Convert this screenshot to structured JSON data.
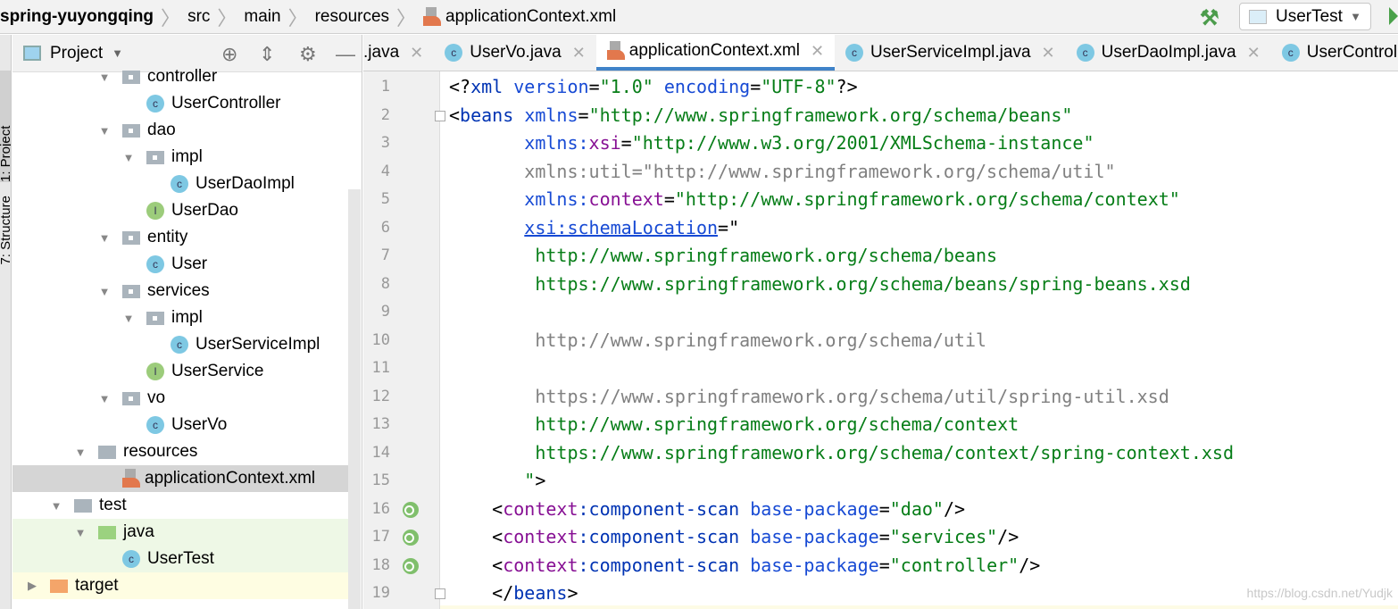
{
  "breadcrumb": [
    "spring-yuyongqing",
    "src",
    "main",
    "resources",
    "applicationContext.xml"
  ],
  "run_config": "UserTest",
  "tool_strip": [
    "1: Project",
    "7: Structure"
  ],
  "project_panel": {
    "title": "Project",
    "tree": [
      {
        "label": "controller",
        "kind": "pkg",
        "level": 4,
        "arrow": "▼"
      },
      {
        "label": "UserController",
        "kind": "class",
        "level": 5
      },
      {
        "label": "dao",
        "kind": "pkg",
        "level": 4,
        "arrow": "▼"
      },
      {
        "label": "impl",
        "kind": "pkg",
        "level": 5,
        "arrow": "▼"
      },
      {
        "label": "UserDaoImpl",
        "kind": "class",
        "level": 6
      },
      {
        "label": "UserDao",
        "kind": "iface",
        "level": 5
      },
      {
        "label": "entity",
        "kind": "pkg",
        "level": 4,
        "arrow": "▼"
      },
      {
        "label": "User",
        "kind": "class",
        "level": 5
      },
      {
        "label": "services",
        "kind": "pkg",
        "level": 4,
        "arrow": "▼"
      },
      {
        "label": "impl",
        "kind": "pkg",
        "level": 5,
        "arrow": "▼"
      },
      {
        "label": "UserServiceImpl",
        "kind": "class",
        "level": 6
      },
      {
        "label": "UserService",
        "kind": "iface",
        "level": 5
      },
      {
        "label": "vo",
        "kind": "pkg",
        "level": 4,
        "arrow": "▼"
      },
      {
        "label": "UserVo",
        "kind": "class",
        "level": 5
      },
      {
        "label": "resources",
        "kind": "res",
        "level": 3,
        "arrow": "▼"
      },
      {
        "label": "applicationContext.xml",
        "kind": "xml",
        "level": 4,
        "selected": true
      },
      {
        "label": "test",
        "kind": "folder",
        "level": 2,
        "arrow": "▼"
      },
      {
        "label": "java",
        "kind": "green",
        "level": 3,
        "arrow": "▼",
        "bg": "green"
      },
      {
        "label": "UserTest",
        "kind": "test",
        "level": 4,
        "bg": "green"
      },
      {
        "label": "target",
        "kind": "orange",
        "level": 1,
        "arrow": "▶",
        "bg": "yellow"
      }
    ]
  },
  "tabs": [
    {
      "label": ".java",
      "icon": "none"
    },
    {
      "label": "UserVo.java",
      "icon": "class"
    },
    {
      "label": "applicationContext.xml",
      "icon": "xml",
      "active": true
    },
    {
      "label": "UserServiceImpl.java",
      "icon": "class"
    },
    {
      "label": "UserDaoImpl.java",
      "icon": "class"
    },
    {
      "label": "UserController",
      "icon": "class",
      "noclose": true
    }
  ],
  "editor": {
    "lines": [
      [
        [
          "p",
          "<?"
        ],
        [
          "tag",
          "xml"
        ],
        [
          "p",
          " "
        ],
        [
          "attr",
          "version"
        ],
        [
          "p",
          "="
        ],
        [
          "val",
          "\"1.0\""
        ],
        [
          "p",
          " "
        ],
        [
          "attr",
          "encoding"
        ],
        [
          "p",
          "="
        ],
        [
          "val",
          "\"UTF-8\""
        ],
        [
          "p",
          "?>"
        ]
      ],
      [
        [
          "p",
          "<"
        ],
        [
          "tag",
          "beans"
        ],
        [
          "p",
          " "
        ],
        [
          "attr",
          "xmlns"
        ],
        [
          "p",
          "="
        ],
        [
          "val",
          "\"http://www.springframework.org/schema/beans\""
        ]
      ],
      [
        [
          "p",
          "       "
        ],
        [
          "attr",
          "xmlns:"
        ],
        [
          "ns",
          "xsi"
        ],
        [
          "p",
          "="
        ],
        [
          "val",
          "\"http://www.w3.org/2001/XMLSchema-instance\""
        ]
      ],
      [
        [
          "p",
          "       "
        ],
        [
          "gray",
          "xmlns:util=\"http://www.springframework.org/schema/util\""
        ]
      ],
      [
        [
          "p",
          "       "
        ],
        [
          "attr",
          "xmlns:"
        ],
        [
          "ns",
          "context"
        ],
        [
          "p",
          "="
        ],
        [
          "val",
          "\"http://www.springframework.org/schema/context\""
        ]
      ],
      [
        [
          "p",
          "       "
        ],
        [
          "und",
          "xsi:schemaLocation"
        ],
        [
          "p",
          "=\""
        ]
      ],
      [
        [
          "p",
          "        "
        ],
        [
          "val",
          "http://www.springframework.org/schema/beans"
        ]
      ],
      [
        [
          "p",
          "        "
        ],
        [
          "val",
          "https://www.springframework.org/schema/beans/spring-beans.xsd"
        ]
      ],
      [],
      [
        [
          "p",
          "        "
        ],
        [
          "gray",
          "http://www.springframework.org/schema/util"
        ]
      ],
      [],
      [
        [
          "p",
          "        "
        ],
        [
          "gray",
          "https://www.springframework.org/schema/util/spring-util.xsd"
        ]
      ],
      [
        [
          "p",
          "        "
        ],
        [
          "val",
          "http://www.springframework.org/schema/context"
        ]
      ],
      [
        [
          "p",
          "        "
        ],
        [
          "val",
          "https://www.springframework.org/schema/context/spring-context.xsd"
        ]
      ],
      [
        [
          "p",
          "       "
        ],
        [
          "val",
          "\""
        ],
        [
          "p",
          ">"
        ]
      ],
      [
        [
          "p",
          "    <"
        ],
        [
          "ns",
          "context"
        ],
        [
          "tag",
          ":component-scan"
        ],
        [
          "p",
          " "
        ],
        [
          "attr",
          "base-package"
        ],
        [
          "p",
          "="
        ],
        [
          "val",
          "\"dao\""
        ],
        [
          "p",
          "/>"
        ]
      ],
      [
        [
          "p",
          "    <"
        ],
        [
          "ns",
          "context"
        ],
        [
          "tag",
          ":component-scan"
        ],
        [
          "p",
          " "
        ],
        [
          "attr",
          "base-package"
        ],
        [
          "p",
          "="
        ],
        [
          "val",
          "\"services\""
        ],
        [
          "p",
          "/>"
        ]
      ],
      [
        [
          "p",
          "    <"
        ],
        [
          "ns",
          "context"
        ],
        [
          "tag",
          ":component-scan"
        ],
        [
          "p",
          " "
        ],
        [
          "attr",
          "base-package"
        ],
        [
          "p",
          "="
        ],
        [
          "val",
          "\"controller\""
        ],
        [
          "p",
          "/>"
        ]
      ],
      [
        [
          "p",
          "    </"
        ],
        [
          "tag",
          "beans"
        ],
        [
          "p",
          ">"
        ]
      ]
    ],
    "bean_gutter_lines": [
      16,
      17,
      18
    ]
  },
  "watermark": "https://blog.csdn.net/Yudjk"
}
